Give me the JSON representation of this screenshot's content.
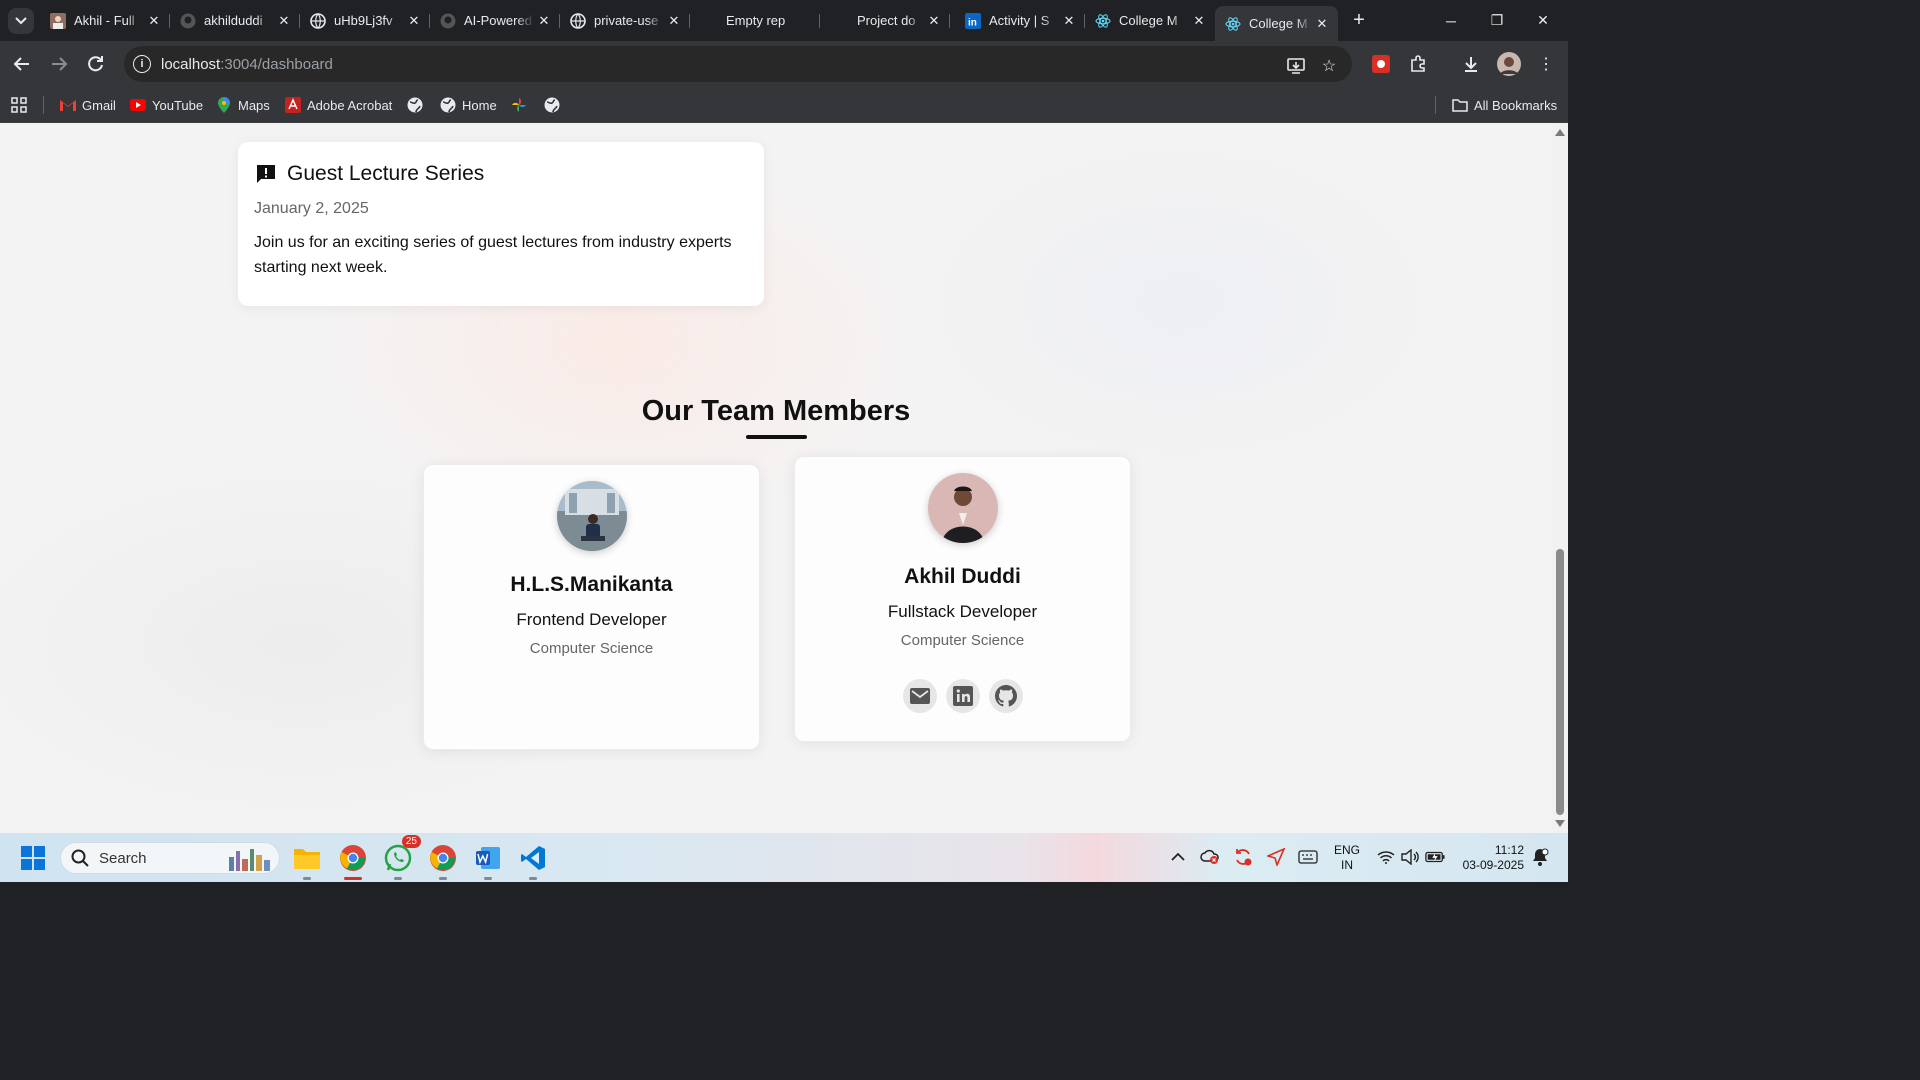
{
  "browser": {
    "tabs": [
      {
        "title": "Akhil - Full",
        "favicon": "avatar-favicon"
      },
      {
        "title": "akhilduddi",
        "favicon": "github-icon"
      },
      {
        "title": "uHb9Lj3fv",
        "favicon": "globe-icon"
      },
      {
        "title": "AI-Powered",
        "favicon": "github-icon"
      },
      {
        "title": "private-use",
        "favicon": "globe-icon"
      },
      {
        "title": "Empty rep",
        "favicon": "none"
      },
      {
        "title": "Project do",
        "favicon": "none"
      },
      {
        "title": "Activity | S",
        "favicon": "linkedin-icon"
      },
      {
        "title": "College M",
        "favicon": "react-icon"
      },
      {
        "title": "College M",
        "favicon": "react-icon",
        "active": true
      }
    ],
    "url_host": "localhost",
    "url_rest": ":3004/dashboard",
    "bookmarks": [
      {
        "label": "Gmail",
        "icon": "gmail-icon"
      },
      {
        "label": "YouTube",
        "icon": "youtube-icon"
      },
      {
        "label": "Maps",
        "icon": "maps-icon"
      },
      {
        "label": "Adobe Acrobat",
        "icon": "acrobat-icon"
      },
      {
        "label": "",
        "icon": "globe-icon"
      },
      {
        "label": "Home",
        "icon": "globe-icon"
      },
      {
        "label": "",
        "icon": "pinwheel-icon"
      },
      {
        "label": "",
        "icon": "globe-icon"
      }
    ],
    "all_bookmarks": "All Bookmarks"
  },
  "notice": {
    "title": "Guest Lecture Series",
    "date": "January 2, 2025",
    "text": "Join us for an exciting series of guest lectures from industry experts starting next week.",
    "icon": "announcement-icon"
  },
  "team": {
    "heading": "Our Team Members",
    "members": [
      {
        "name": "H.L.S.Manikanta",
        "role": "Frontend Developer",
        "dept": "Computer Science"
      },
      {
        "name": "Akhil Duddi",
        "role": "Fullstack Developer",
        "dept": "Computer Science",
        "socials": [
          "email-icon",
          "linkedin-icon",
          "github-icon"
        ]
      }
    ]
  },
  "taskbar": {
    "search_label": "Search",
    "whatsapp_badge": "25",
    "lang_line1": "ENG",
    "lang_line2": "IN",
    "time": "11:12",
    "date": "03-09-2025"
  },
  "colors": {
    "browser_dark": "#202124",
    "toolbar": "#35363a",
    "page_bg": "#f4f3f3",
    "card_bg": "#ffffff",
    "accent_red": "#d93025"
  }
}
